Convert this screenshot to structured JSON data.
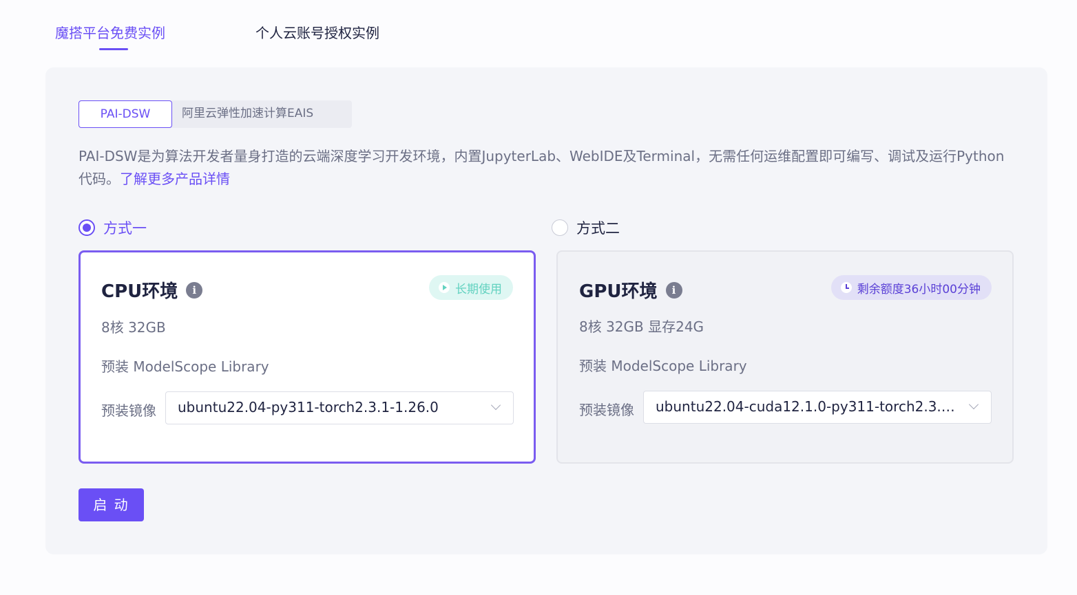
{
  "tabs": {
    "active": "魔搭平台免费实例",
    "inactive": "个人云账号授权实例"
  },
  "segment": {
    "active": "PAI-DSW",
    "inactive": "阿里云弹性加速计算EAIS"
  },
  "description": {
    "text": "PAI-DSW是为算法开发者量身打造的云端深度学习开发环境，内置JupyterLab、WebIDE及Terminal，无需任何运维配置即可编写、调试及运行Python代码。",
    "link": "了解更多产品详情"
  },
  "options": {
    "one": {
      "label": "方式一",
      "selected": true
    },
    "two": {
      "label": "方式二",
      "selected": false
    }
  },
  "cpu": {
    "title": "CPU环境",
    "info_icon": "i",
    "badge": "长期使用",
    "spec": "8核 32GB",
    "library": "预装 ModelScope Library",
    "image_label": "预装镜像",
    "image_value": "ubuntu22.04-py311-torch2.3.1-1.26.0"
  },
  "gpu": {
    "title": "GPU环境",
    "info_icon": "i",
    "badge": "剩余额度36小时00分钟",
    "spec": "8核 32GB 显存24G",
    "library": "预装 ModelScope Library",
    "image_label": "预装镜像",
    "image_value": "ubuntu22.04-cuda12.1.0-py311-torch2.3.1..."
  },
  "start_button": "启 动",
  "colors": {
    "accent": "#6a4ff5",
    "teal_badge_text": "#63d2c0",
    "teal_badge_bg": "#dff7f3",
    "purple_badge_bg": "#e2e0f7"
  },
  "icons": {
    "info": "info-icon",
    "play": "play-icon",
    "clock": "clock-icon",
    "chevron": "chevron-down-icon"
  }
}
